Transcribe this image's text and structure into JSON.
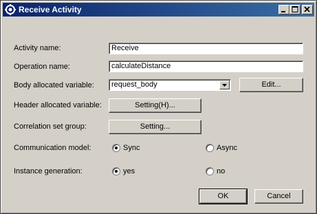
{
  "window": {
    "title": "Receive Activity",
    "controls": {
      "minimize": "minimize",
      "maximize": "maximize",
      "close": "close"
    }
  },
  "form": {
    "activity_name_label": "Activity name:",
    "activity_name_value": "Receive",
    "operation_name_label": "Operation name:",
    "operation_name_value": "calculateDistance",
    "body_variable_label": "Body allocated variable:",
    "body_variable_value": "request_body",
    "body_edit_button": "Edit...",
    "header_variable_label": "Header allocated variable:",
    "header_setting_button": "Setting(H)...",
    "correlation_label": "Correlation set group:",
    "correlation_setting_button": "Setting...",
    "communication_model_label": "Communication model:",
    "communication_options": [
      "Sync",
      "Async"
    ],
    "communication_selected": "Sync",
    "instance_generation_label": "Instance generation:",
    "instance_options": [
      "yes",
      "no"
    ],
    "instance_selected": "yes"
  },
  "footer": {
    "ok_label": "OK",
    "cancel_label": "Cancel"
  },
  "icons": {
    "window_icon": "gear-icon",
    "combo_arrow": "chevron-down-icon"
  }
}
